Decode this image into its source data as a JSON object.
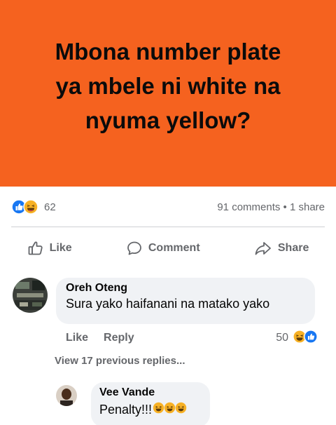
{
  "post": {
    "banner_line1": "Mbona number plate",
    "banner_line2": "ya mbele ni white na",
    "banner_line3": "nyuma yellow?",
    "banner_bg": "#f5621f",
    "reaction_icons": [
      "like-reaction-icon",
      "haha-reaction-icon"
    ],
    "reaction_count": "62",
    "comments_share": "91 comments • 1 share"
  },
  "actions": {
    "like": "Like",
    "comment": "Comment",
    "share": "Share"
  },
  "comment": {
    "author": "Oreh Oteng",
    "text": "Sura yako haifanani na matako yako",
    "like": "Like",
    "reply": "Reply",
    "reaction_count": "50",
    "reaction_icons": [
      "haha-reaction-icon",
      "like-reaction-icon"
    ]
  },
  "replies": {
    "view_more": "View 17 previous replies...",
    "reply_author": "Vee Vande",
    "reply_text": "Penalty!!!",
    "reply_emojis": [
      "laughing-emoji-icon",
      "laughing-emoji-icon",
      "laughing-emoji-icon"
    ]
  },
  "colors": {
    "facebook_blue": "#1877f2",
    "haha_yellow": "#f7b125",
    "muted_text": "#65676b"
  }
}
